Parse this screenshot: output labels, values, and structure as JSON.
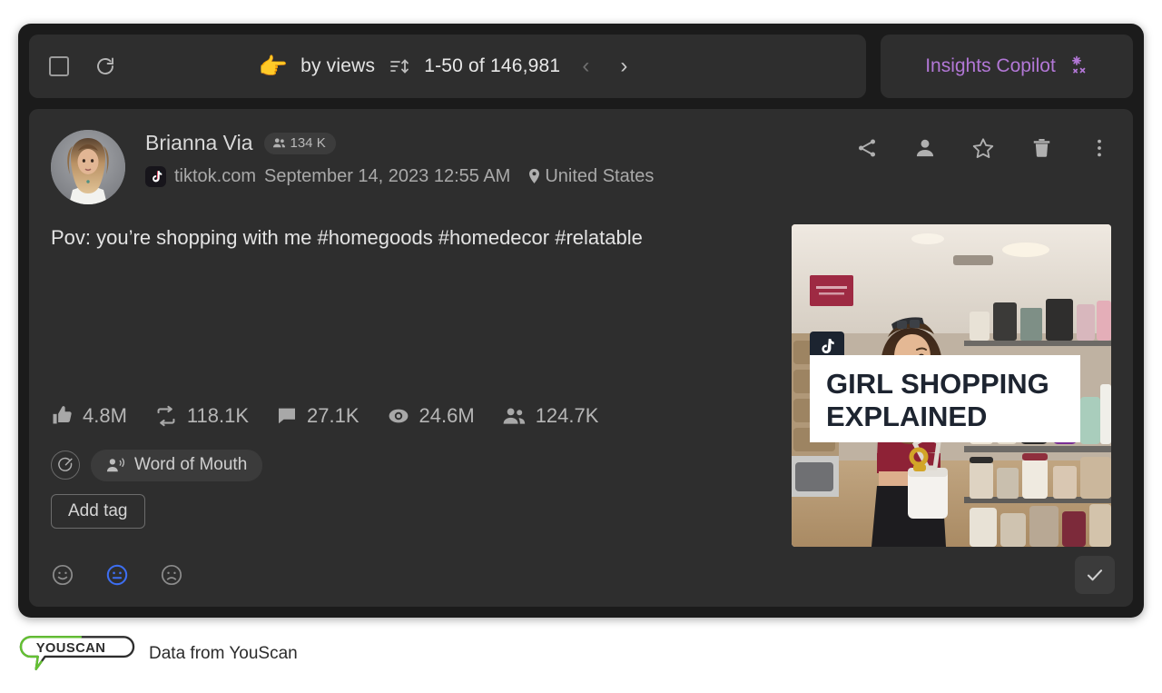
{
  "toolbar": {
    "select_all_name": "select-all-checkbox",
    "refresh_name": "refresh-icon",
    "sort_emoji": "👉",
    "sort_label": "by views",
    "sort_icon": "sort-icon",
    "range_label": "1-50 of 146,981",
    "prev_label": "‹",
    "next_label": "›",
    "copilot_label": "Insights Copilot",
    "copilot_icon": "sparkle-icon",
    "copilot_color": "#b277d6"
  },
  "post": {
    "author": "Brianna Via",
    "followers": "134 K",
    "source": "tiktok.com",
    "date": "September 14, 2023 12:55 AM",
    "location": "United States",
    "text": "Pov: you’re shopping with me #homegoods #homedecor #relatable",
    "actions": [
      {
        "name": "share-icon",
        "label": "Share"
      },
      {
        "name": "author-icon",
        "label": "Author"
      },
      {
        "name": "star-icon",
        "label": "Favorite"
      },
      {
        "name": "trash-icon",
        "label": "Delete"
      },
      {
        "name": "more-vertical-icon",
        "label": "More"
      }
    ],
    "metrics": [
      {
        "icon": "thumbs-up-icon",
        "label": "Likes",
        "value": "4.8M"
      },
      {
        "icon": "repost-icon",
        "label": "Reposts",
        "value": "118.1K"
      },
      {
        "icon": "comment-icon",
        "label": "Comments",
        "value": "27.1K"
      },
      {
        "icon": "eye-icon",
        "label": "Views",
        "value": "24.6M"
      },
      {
        "icon": "audience-icon",
        "label": "Audience",
        "value": "124.7K"
      }
    ],
    "tags": [
      {
        "icon": "word-of-mouth-icon",
        "label": "Word of Mouth"
      }
    ],
    "add_tag_label": "Add tag",
    "sentiments": [
      {
        "name": "sentiment-positive",
        "state": "unselected"
      },
      {
        "name": "sentiment-neutral",
        "state": "selected"
      },
      {
        "name": "sentiment-negative",
        "state": "unselected"
      }
    ],
    "confirm_icon": "check-icon",
    "thumbnail": {
      "caption_line1": "GIRL SHOPPING",
      "caption_line2": "EXPLAINED",
      "badge": "tiktok-badge",
      "alt": "Woman shopping in a home goods store holding a drink, shelves of candles behind her"
    }
  },
  "footer": {
    "logo_text": "YOUSCAN",
    "caption": "Data from YouScan",
    "logo_green": "#63c132"
  }
}
